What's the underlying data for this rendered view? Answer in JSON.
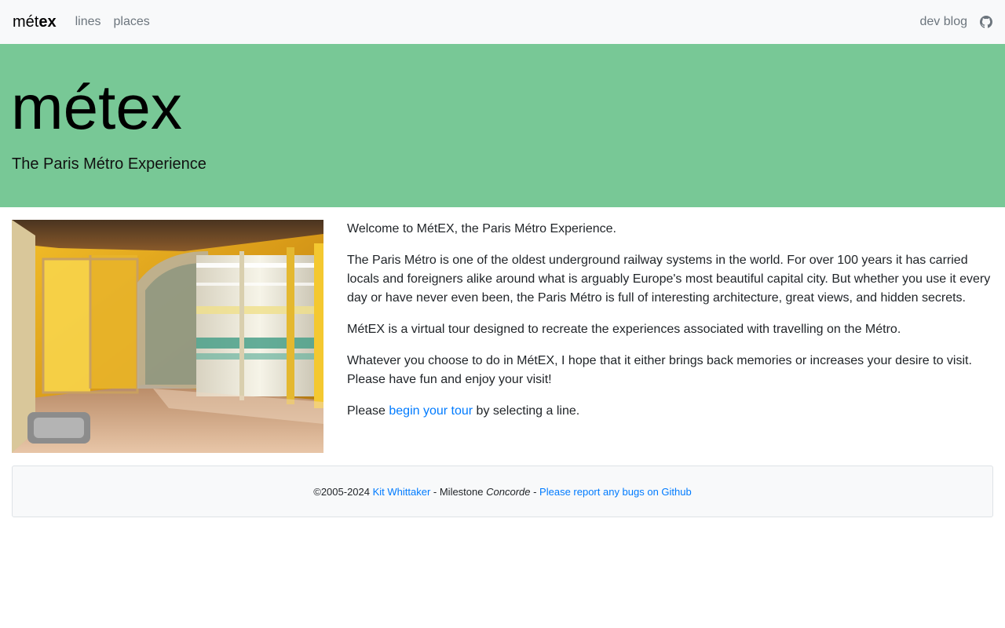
{
  "navbar": {
    "brand_light": "mét",
    "brand_bold": "ex",
    "links": [
      "lines",
      "places"
    ],
    "right_link": "dev blog",
    "github_icon": "github-icon"
  },
  "jumbotron": {
    "title": "métex",
    "lead": "The Paris Métro Experience"
  },
  "content": {
    "image_alt": "Métro station platform with screen doors",
    "p1": "Welcome to MétEX, the Paris Métro Experience.",
    "p2": "The Paris Métro is one of the oldest underground railway systems in the world. For over 100 years it has carried locals and foreigners alike around what is arguably Europe's most beautiful capital city. But whether you use it every day or have never even been, the Paris Métro is full of interesting architecture, great views, and hidden secrets.",
    "p3": "MétEX is a virtual tour designed to recreate the experiences associated with travelling on the Métro.",
    "p4": "Whatever you choose to do in MétEX, I hope that it either brings back memories or increases your desire to visit. Please have fun and enjoy your visit!",
    "p5_before": "Please ",
    "p5_link": "begin your tour",
    "p5_after": " by selecting a line."
  },
  "footer": {
    "copyright": "©2005-2024 ",
    "author": "Kit Whittaker",
    "milestone_prefix": " - Milestone ",
    "milestone_name": "Concorde",
    "separator": " - ",
    "bug_link": "Please report any bugs on Github"
  },
  "colors": {
    "jumbotron_bg": "#78c896",
    "navbar_bg": "#f8f9fa",
    "link": "#007bff"
  }
}
